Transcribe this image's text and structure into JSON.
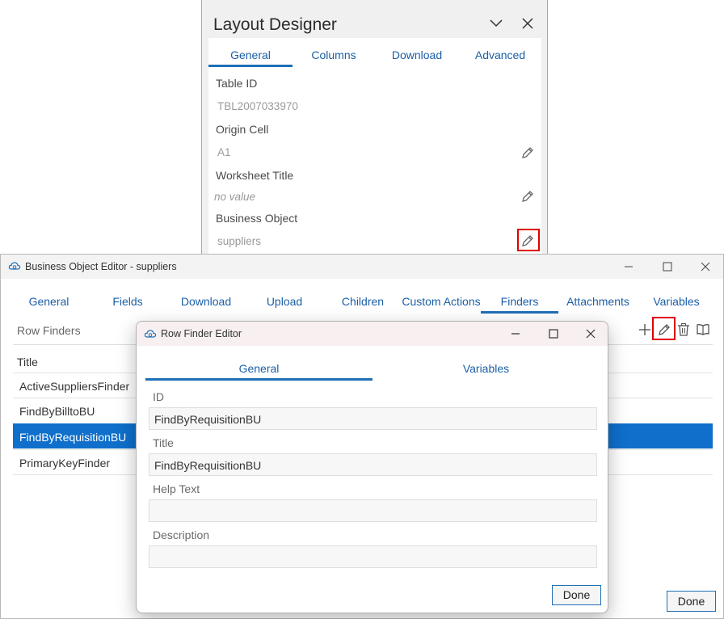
{
  "layout_designer": {
    "title": "Layout Designer",
    "tabs": [
      "General",
      "Columns",
      "Download",
      "Advanced"
    ],
    "active_tab": "General",
    "fields": {
      "table_id_label": "Table ID",
      "table_id_value": "TBL2007033970",
      "origin_cell_label": "Origin Cell",
      "origin_cell_value": "A1",
      "worksheet_title_label": "Worksheet Title",
      "worksheet_title_value": "no value",
      "business_object_label": "Business Object",
      "business_object_value": "suppliers"
    },
    "icons": [
      "chevron-down-icon",
      "close-icon",
      "pencil-icon"
    ]
  },
  "business_object_editor": {
    "title": "Business Object Editor - suppliers",
    "tabs": [
      "General",
      "Fields",
      "Download",
      "Upload",
      "Children",
      "Custom Actions",
      "Finders",
      "Attachments",
      "Variables"
    ],
    "active_tab": "Finders",
    "section_label": "Row Finders",
    "column_header": "Title",
    "rows": [
      "ActiveSuppliersFinder",
      "FindByBilltoBU",
      "FindByRequisitionBU",
      "PrimaryKeyFinder"
    ],
    "selected_row": "FindByRequisitionBU",
    "toolbar_icons": [
      "plus-icon",
      "pencil-icon",
      "trash-icon",
      "book-icon"
    ],
    "done_label": "Done"
  },
  "row_finder_editor": {
    "title": "Row Finder Editor",
    "tabs": [
      "General",
      "Variables"
    ],
    "active_tab": "General",
    "id_label": "ID",
    "id_value": "FindByRequisitionBU",
    "title_label": "Title",
    "title_value": "FindByRequisitionBU",
    "help_text_label": "Help Text",
    "help_text_value": "",
    "description_label": "Description",
    "description_value": "",
    "done_label": "Done"
  },
  "colors": {
    "accent": "#1f6fb7",
    "selection": "#0f6fca",
    "highlight_box": "#e00000"
  }
}
